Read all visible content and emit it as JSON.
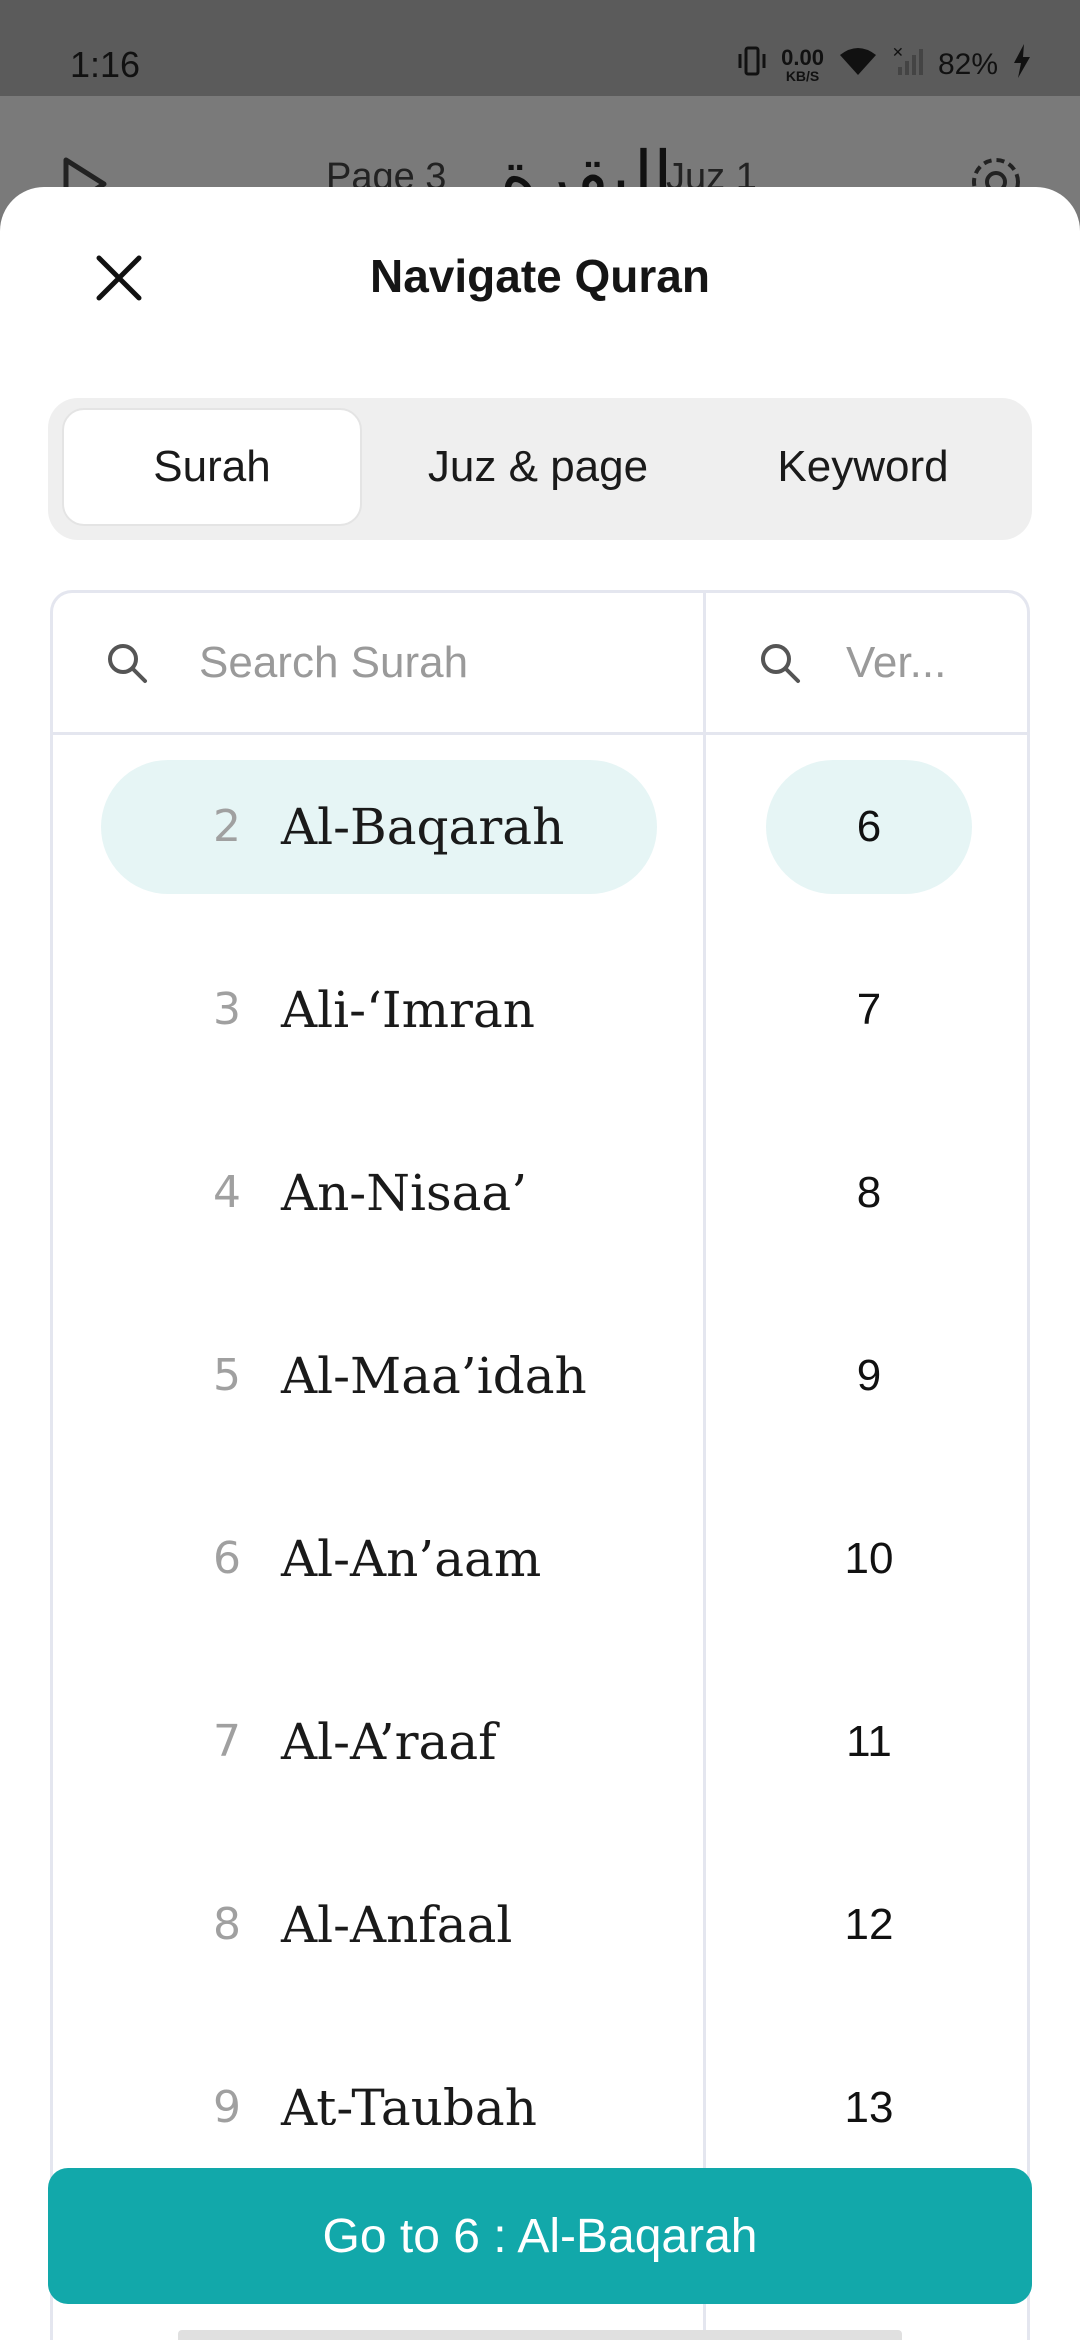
{
  "status_bar": {
    "time": "1:16",
    "net_speed_value": "0.00",
    "net_speed_unit": "KB/S",
    "battery": "82%"
  },
  "background_header": {
    "page_label": "Page 3",
    "surah_calligraphy": "البقرة",
    "juz_label": "Juz 1"
  },
  "sheet": {
    "title": "Navigate Quran",
    "tabs": [
      {
        "label": "Surah",
        "active": true
      },
      {
        "label": "Juz & page",
        "active": false
      },
      {
        "label": "Keyword",
        "active": false
      }
    ],
    "surah_search_placeholder": "Search Surah",
    "verse_search_placeholder": "Ver...",
    "surahs": [
      {
        "number": "2",
        "name": "Al-Baqarah",
        "selected": true
      },
      {
        "number": "3",
        "name": "Ali-‘Imran",
        "selected": false
      },
      {
        "number": "4",
        "name": "An-Nisaa’",
        "selected": false
      },
      {
        "number": "5",
        "name": "Al-Maa’idah",
        "selected": false
      },
      {
        "number": "6",
        "name": "Al-An’aam",
        "selected": false
      },
      {
        "number": "7",
        "name": "Al-A’raaf",
        "selected": false
      },
      {
        "number": "8",
        "name": "Al-Anfaal",
        "selected": false
      },
      {
        "number": "9",
        "name": "At-Taubah",
        "selected": false
      }
    ],
    "verses": [
      "6",
      "7",
      "8",
      "9",
      "10",
      "11",
      "12",
      "13"
    ],
    "selected_verse": "6",
    "go_button_label": "Go to 6 : Al-Baqarah"
  },
  "colors": {
    "accent": "#12a8aa",
    "selection_bg": "#e6f5f5"
  }
}
